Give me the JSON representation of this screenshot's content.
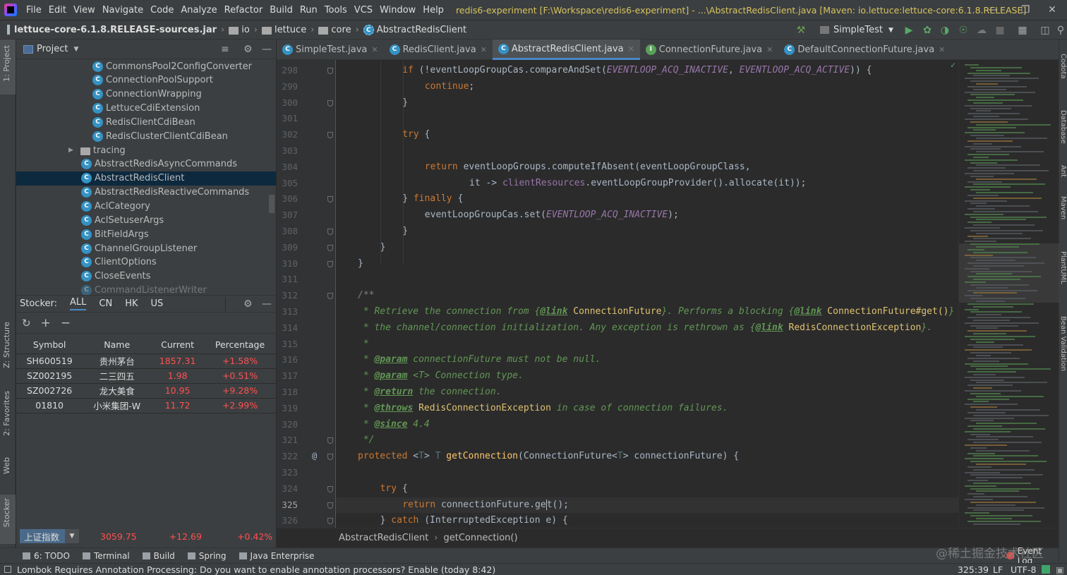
{
  "menubar": {
    "items": [
      "File",
      "Edit",
      "View",
      "Navigate",
      "Code",
      "Analyze",
      "Refactor",
      "Build",
      "Run",
      "Tools",
      "VCS",
      "Window",
      "Help"
    ],
    "window_title": "redis6-experiment [F:\\Workspace\\redis6-experiment] - ...\\AbstractRedisClient.java [Maven: io.lettuce:lettuce-core:6.1.8.RELEASE]"
  },
  "navbar": {
    "crumbs": [
      "lettuce-core-6.1.8.RELEASE-sources.jar",
      "io",
      "lettuce",
      "core",
      "AbstractRedisClient"
    ],
    "run_config": "SimpleTest"
  },
  "left_stripe": {
    "labels": [
      "1: Project",
      "Z: Structure",
      "2: Favorites",
      "Web",
      "Stocker"
    ]
  },
  "right_stripe": {
    "labels": [
      "Codota",
      "Database",
      "Ant",
      "Maven",
      "PlantUML",
      "Bean Validation"
    ]
  },
  "project": {
    "title": "Project",
    "items": [
      {
        "label": "CommonsPool2ConfigConverter",
        "indent": 2,
        "kind": "class"
      },
      {
        "label": "ConnectionPoolSupport",
        "indent": 2,
        "kind": "class"
      },
      {
        "label": "ConnectionWrapping",
        "indent": 2,
        "kind": "class"
      },
      {
        "label": "LettuceCdiExtension",
        "indent": 2,
        "kind": "class"
      },
      {
        "label": "RedisClientCdiBean",
        "indent": 2,
        "kind": "class"
      },
      {
        "label": "RedisClusterClientCdiBean",
        "indent": 2,
        "kind": "class"
      },
      {
        "label": "tracing",
        "indent": 1,
        "kind": "folder"
      },
      {
        "label": "AbstractRedisAsyncCommands",
        "indent": 1,
        "kind": "class"
      },
      {
        "label": "AbstractRedisClient",
        "indent": 1,
        "kind": "class",
        "selected": true
      },
      {
        "label": "AbstractRedisReactiveCommands",
        "indent": 1,
        "kind": "class"
      },
      {
        "label": "AclCategory",
        "indent": 1,
        "kind": "class"
      },
      {
        "label": "AclSetuserArgs",
        "indent": 1,
        "kind": "class"
      },
      {
        "label": "BitFieldArgs",
        "indent": 1,
        "kind": "class"
      },
      {
        "label": "ChannelGroupListener",
        "indent": 1,
        "kind": "class"
      },
      {
        "label": "ClientOptions",
        "indent": 1,
        "kind": "class"
      },
      {
        "label": "CloseEvents",
        "indent": 1,
        "kind": "class"
      },
      {
        "label": "CommandListenerWriter",
        "indent": 1,
        "kind": "class"
      }
    ]
  },
  "stocker": {
    "label": "Stocker:",
    "tabs": [
      "ALL",
      "CN",
      "HK",
      "US"
    ],
    "columns": [
      "Symbol",
      "Name",
      "Current",
      "Percentage"
    ],
    "rows": [
      [
        "SH600519",
        "贵州茅台",
        "1857.31",
        "+1.58%"
      ],
      [
        "SZ002195",
        "二三四五",
        "1.98",
        "+0.51%"
      ],
      [
        "SZ002726",
        "龙大美食",
        "10.95",
        "+9.28%"
      ],
      [
        "01810",
        "小米集团-W",
        "11.72",
        "+2.99%"
      ]
    ],
    "index": {
      "name": "上证指数",
      "value": "3059.75",
      "change": "+12.69",
      "percent": "+0.42%"
    }
  },
  "tabs": [
    {
      "label": "SimpleTest.java",
      "icon": "c"
    },
    {
      "label": "RedisClient.java",
      "icon": "c"
    },
    {
      "label": "AbstractRedisClient.java",
      "icon": "c",
      "active": true
    },
    {
      "label": "ConnectionFuture.java",
      "icon": "i"
    },
    {
      "label": "DefaultConnectionFuture.java",
      "icon": "c"
    }
  ],
  "editor": {
    "first_line": 298,
    "current_line": 325
  },
  "breadcrumb_bottom": [
    "AbstractRedisClient",
    "getConnection()"
  ],
  "tool_windows": [
    "6: TODO",
    "Terminal",
    "Build",
    "Spring",
    "Java Enterprise"
  ],
  "event_log": "Event Log",
  "status": {
    "message": "Lombok Requires Annotation Processing: Do you want to enable annotation processors? Enable (today 8:42)",
    "position": "325:39",
    "line_sep": "LF",
    "encoding": "UTF-8"
  },
  "watermark": "@稀土掘金技术社区",
  "colors": {
    "accent": "#4a88c7",
    "keyword": "#cc7832",
    "comment": "#629755",
    "up": "#ff5050"
  }
}
